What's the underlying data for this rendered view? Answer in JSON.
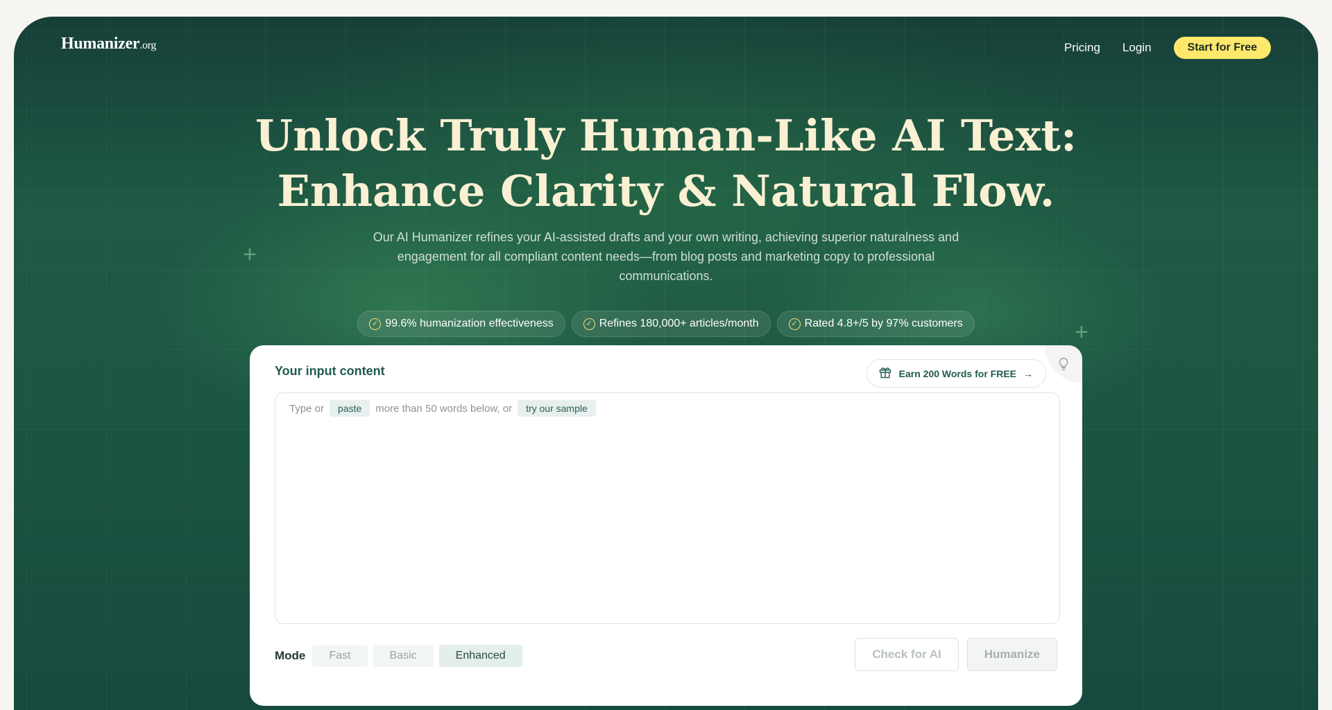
{
  "brand": {
    "name": "Humanizer",
    "suffix": ".org"
  },
  "nav": {
    "pricing": "Pricing",
    "login": "Login",
    "cta": "Start for Free"
  },
  "hero": {
    "title_line1": "Unlock Truly Human-Like AI Text:",
    "title_line2": "Enhance Clarity & Natural Flow.",
    "subtitle": "Our AI Humanizer refines your AI-assisted drafts and your own writing, achieving superior naturalness and engagement for all compliant content needs—from blog posts and marketing copy to professional communications.",
    "stats": [
      "99.6% humanization effectiveness",
      "Refines 180,000+ articles/month",
      "Rated 4.8+/5 by 97% customers"
    ]
  },
  "panel": {
    "title": "Your input content",
    "earn": "Earn 200 Words for FREE",
    "hint_prefix": "Type or",
    "paste": "paste",
    "hint_middle": "more than 50 words below, or",
    "sample": "try our sample",
    "mode_label": "Mode",
    "modes": [
      "Fast",
      "Basic",
      "Enhanced"
    ],
    "active_mode": "Enhanced",
    "check_button": "Check for AI",
    "humanize_button": "Humanize"
  },
  "colors": {
    "accent_yellow": "#fde86b",
    "hero_green": "#1f5a45",
    "title_cream": "#faf0d3"
  },
  "icons": [
    "check-circle-icon",
    "gift-icon",
    "arrow-right-icon",
    "lightbulb-icon"
  ]
}
